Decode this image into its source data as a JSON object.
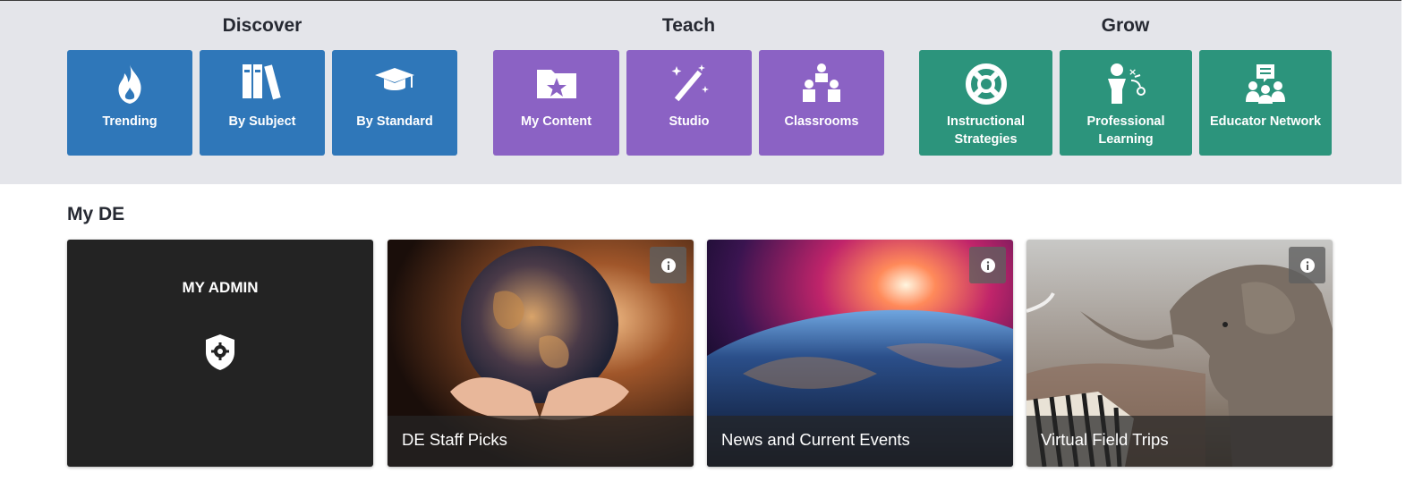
{
  "groups": [
    {
      "title": "Discover",
      "tiles": [
        {
          "label": "Trending",
          "icon": "flame-icon"
        },
        {
          "label": "By Subject",
          "icon": "books-icon"
        },
        {
          "label": "By Standard",
          "icon": "graduation-cap-icon"
        }
      ]
    },
    {
      "title": "Teach",
      "tiles": [
        {
          "label": "My Content",
          "icon": "folder-star-icon"
        },
        {
          "label": "Studio",
          "icon": "magic-wand-icon"
        },
        {
          "label": "Classrooms",
          "icon": "classroom-icon"
        }
      ]
    },
    {
      "title": "Grow",
      "tiles": [
        {
          "label": "Instructional Strategies",
          "icon": "lifebuoy-icon"
        },
        {
          "label": "Professional Learning",
          "icon": "coach-icon"
        },
        {
          "label": "Educator Network",
          "icon": "network-chat-icon"
        }
      ]
    }
  ],
  "colors": {
    "discover": "#2f77b9",
    "teach": "#8b62c4",
    "grow": "#2c947c"
  },
  "my_de": {
    "title": "My DE",
    "admin_card": {
      "title": "MY ADMIN",
      "icon": "shield-gear-icon"
    },
    "cards": [
      {
        "caption": "DE Staff Picks",
        "icon": "info-icon"
      },
      {
        "caption": "News and Current Events",
        "icon": "info-icon"
      },
      {
        "caption": "Virtual Field Trips",
        "icon": "info-icon"
      }
    ]
  }
}
